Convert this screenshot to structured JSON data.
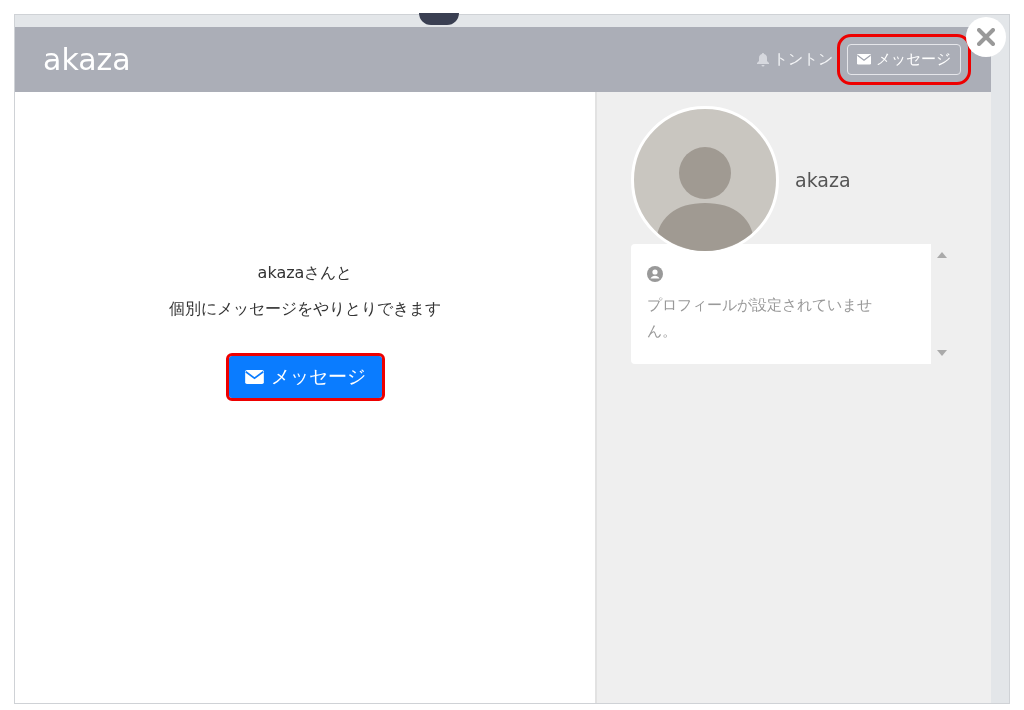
{
  "dialog": {
    "title": "akaza",
    "notify_label": "トントン",
    "header_button": {
      "label": "メッセージ",
      "highlighted": true
    }
  },
  "main": {
    "lines": [
      "akazaさんと",
      "個別にメッセージをやりとりできます"
    ],
    "button": {
      "label": "メッセージ",
      "highlighted": true
    }
  },
  "profile": {
    "name": "akaza",
    "text": "プロフィールが設定されていません。"
  }
}
